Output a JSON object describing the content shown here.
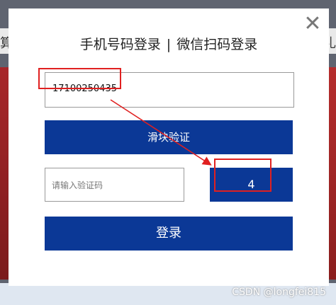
{
  "background": {
    "left_text": "算",
    "right_text": "礼"
  },
  "modal": {
    "close_glyph": "✕",
    "title_left": "手机号码登录",
    "title_separator": "|",
    "title_right": "微信扫码登录",
    "phone_value": "17100250435",
    "slider_label": "滑块验证",
    "code_placeholder": "请输入验证码",
    "code_display": "4",
    "login_label": "登录"
  },
  "annotations": {
    "highlight_color": "#e02020"
  },
  "colors": {
    "button_blue": "#0b3896"
  },
  "watermark": "CSDN @longfei815"
}
